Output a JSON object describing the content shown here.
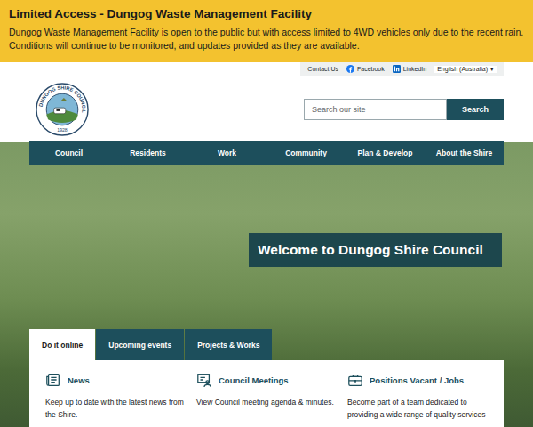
{
  "alert": {
    "title": "Limited Access - Dungog Waste Management Facility",
    "message": "Dungog Waste Management Facility is open to the public but with access limited to 4WD vehicles only due to the recent rain. Conditions will continue to be monitored, and updates provided as they are available."
  },
  "utility_links": [
    {
      "label": "Contact Us",
      "kind": "plain"
    },
    {
      "label": "Facebook",
      "kind": "facebook"
    },
    {
      "label": "LinkedIn",
      "kind": "linkedin"
    }
  ],
  "language": {
    "label": "English (Australia)",
    "caret": "▾"
  },
  "logo": {
    "ring_text": "DUNGOG SHIRE COUNCIL",
    "year": "1928"
  },
  "search": {
    "placeholder": "Search our site",
    "button": "Search"
  },
  "nav": [
    {
      "label": "Council"
    },
    {
      "label": "Residents"
    },
    {
      "label": "Work"
    },
    {
      "label": "Community"
    },
    {
      "label": "Plan & Develop"
    },
    {
      "label": "About the Shire"
    }
  ],
  "hero": {
    "title": "Welcome to Dungog Shire Council"
  },
  "tabs": [
    {
      "label": "Do it online",
      "selected": true
    },
    {
      "label": "Upcoming events",
      "selected": false
    },
    {
      "label": "Projects & Works",
      "selected": false
    }
  ],
  "cards": [
    {
      "title": "News",
      "description": "Keep up to date with the latest news from the Shire.",
      "kind": "news"
    },
    {
      "title": "Council Meetings",
      "description": "View Council meeting agenda & minutes.",
      "kind": "meetings"
    },
    {
      "title": "Positions Vacant / Jobs",
      "description": "Become part of a team dedicated to providing a wide range of quality services",
      "kind": "jobs"
    }
  ]
}
